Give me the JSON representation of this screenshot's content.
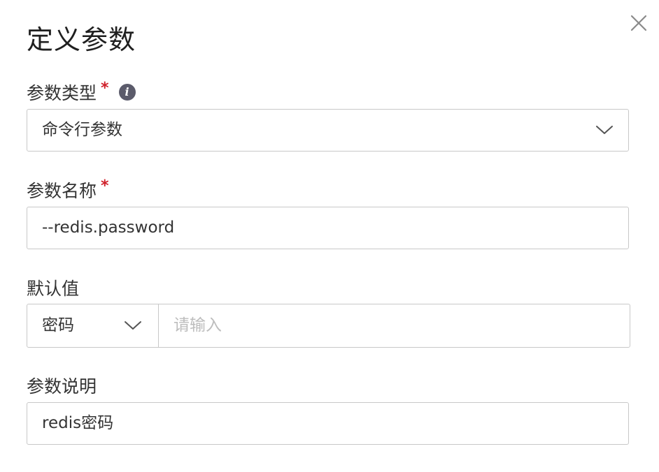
{
  "dialog": {
    "title": "定义参数",
    "close_icon": "close-icon"
  },
  "param_type": {
    "label": "参数类型",
    "required_mark": "*",
    "info_icon": "info-icon",
    "info_glyph": "i",
    "value": "命令行参数"
  },
  "param_name": {
    "label": "参数名称",
    "required_mark": "*",
    "value": "--redis.password"
  },
  "default_value": {
    "label": "默认值",
    "type_value": "密码",
    "input_value": "",
    "placeholder": "请输入"
  },
  "param_desc": {
    "label": "参数说明",
    "value": "redis密码"
  },
  "colors": {
    "required": "#d0212b",
    "border": "#c8c8c8",
    "placeholder": "#bdbdbd",
    "text": "#333333"
  }
}
